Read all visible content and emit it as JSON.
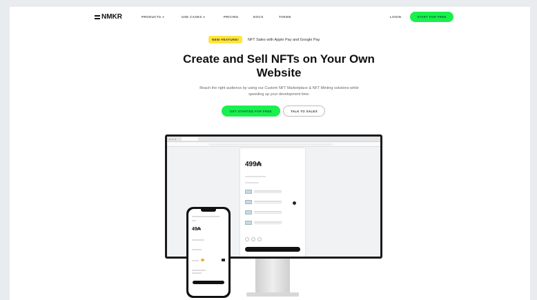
{
  "nav": {
    "logo": "NMKR",
    "links": [
      {
        "label": "PRODUCTS",
        "caret": "▾"
      },
      {
        "label": "USE CASES",
        "caret": "▾"
      },
      {
        "label": "PRICING",
        "caret": ""
      },
      {
        "label": "DOCS",
        "caret": ""
      },
      {
        "label": "TOKEN",
        "caret": ""
      }
    ],
    "login": "LOGIN",
    "cta": "START FOR FREE"
  },
  "hero": {
    "badge": "NEW FEATURE!",
    "badge_text": "NFT Sales with Apple Pay and Google Pay",
    "title": "Create and Sell NFTs on Your Own Website",
    "subtitle": "Reach the right audience by using our Custom NFT Marketplace & NFT Minting solutions while speeding up your development time.",
    "primary_button": "GET STARTED FOR FREE",
    "secondary_button": "TALK TO SALES"
  },
  "mockup": {
    "desktop_price": "499₳",
    "phone_price": "49₳"
  },
  "colors": {
    "accent": "#19f04d",
    "badge": "#ffe53b",
    "text": "#111111"
  }
}
